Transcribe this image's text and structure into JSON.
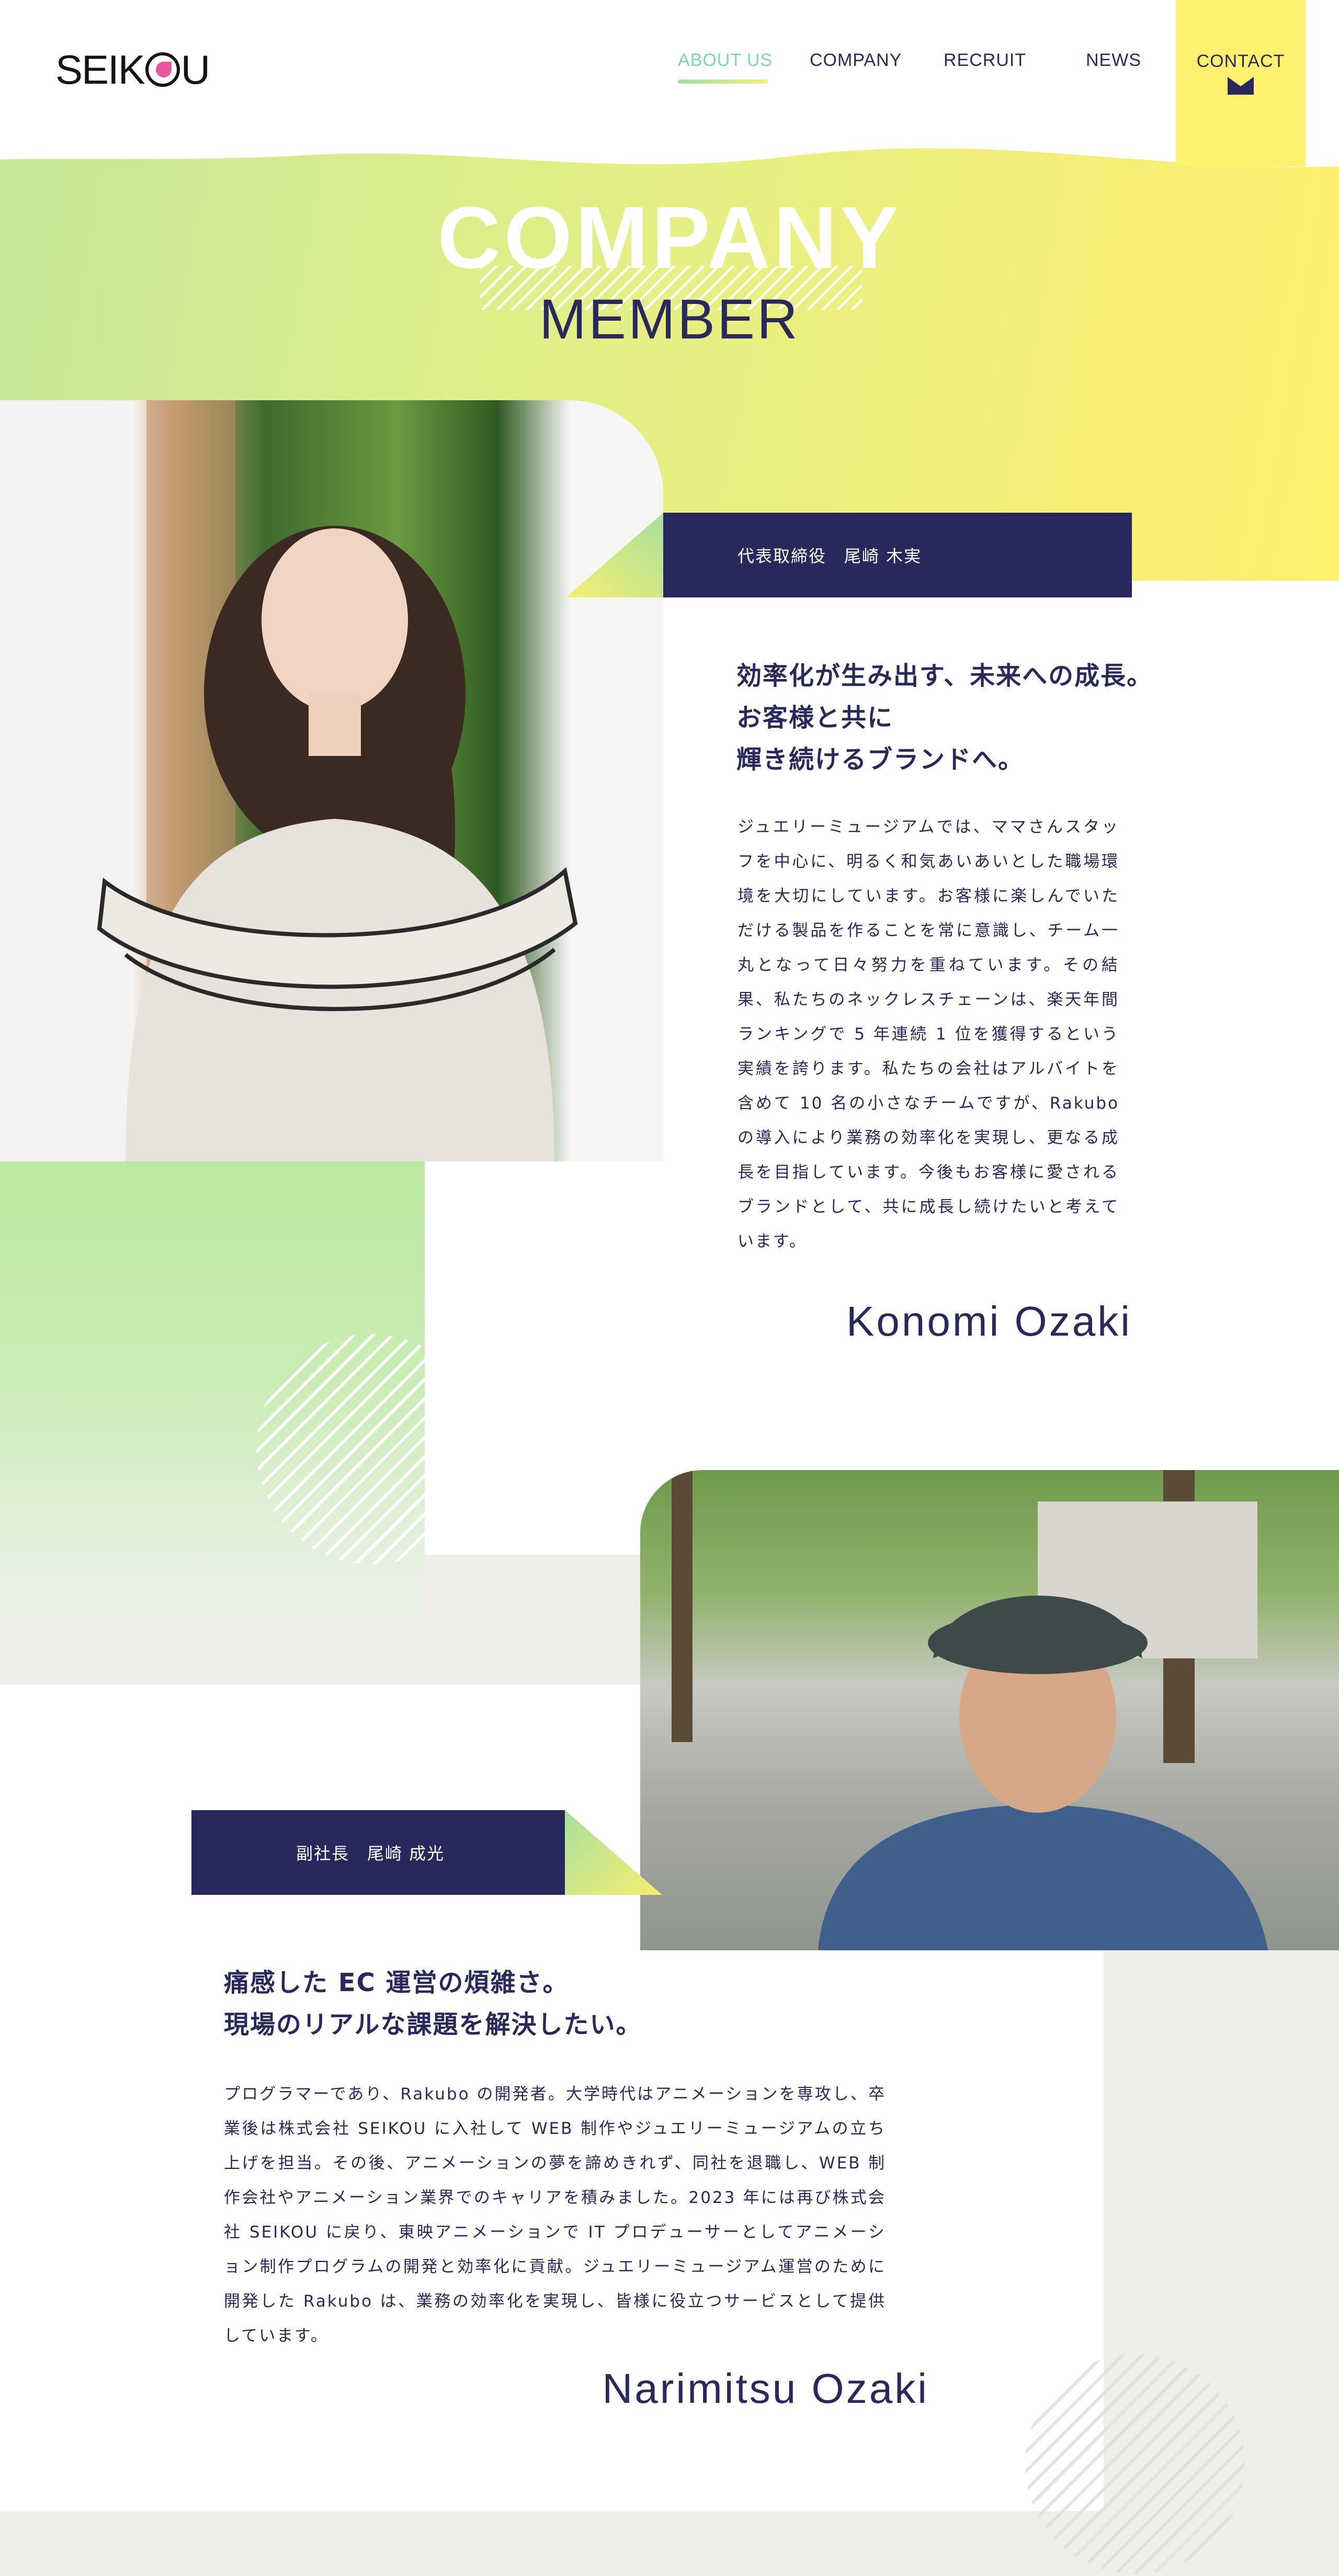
{
  "brand": {
    "logo_text_a": "SEIK",
    "logo_text_b": "U"
  },
  "nav": {
    "items": [
      {
        "label": "ABOUT US",
        "active": true
      },
      {
        "label": "COMPANY",
        "active": false
      },
      {
        "label": "RECRUIT",
        "active": false
      },
      {
        "label": "NEWS",
        "active": false
      }
    ],
    "contact_label": "CONTACT"
  },
  "hero": {
    "title": "COMPANY",
    "subtitle": "MEMBER"
  },
  "members": [
    {
      "role_name": "代表取締役　尾崎 木実",
      "lead": [
        "効率化が生み出す、未来への成長。",
        "お客様と共に",
        "輝き続けるブランドへ。"
      ],
      "body": "ジュエリーミュージアムでは、ママさんスタッフを中心に、明るく和気あいあいとした職場環境を大切にしています。お客様に楽しんでいただける製品を作ることを常に意識し、チーム一丸となって日々努力を重ねています。その結果、私たちのネックレスチェーンは、楽天年間ランキングで 5 年連続 1 位を獲得するという実績を誇ります。私たちの会社はアルバイトを含めて 10 名の小さなチームですが、Rakubo の導入により業務の効率化を実現し、更なる成長を目指しています。今後もお客様に愛されるブランドとして、共に成長し続けたいと考えています。",
      "signature": "Konomi Ozaki"
    },
    {
      "role_name": "副社長　尾崎 成光",
      "lead": [
        "痛感した EC 運営の煩雑さ。",
        "現場のリアルな課題を解決したい。"
      ],
      "body": "プログラマーであり、Rakubo の開発者。大学時代はアニメーションを専攻し、卒業後は株式会社 SEIKOU に入社して WEB 制作やジュエリーミュージアムの立ち上げを担当。その後、アニメーションの夢を諦めきれず、同社を退職し、WEB 制作会社やアニメーション業界でのキャリアを積みました。2023 年には再び株式会社 SEIKOU に戻り、東映アニメーションで IT プロデューサーとしてアニメーション制作プログラムの開発と効率化に貢献。ジュエリーミュージアム運営のために開発した Rakubo は、業務の効率化を実現し、皆様に役立つサービスとして提供しています。",
      "signature": "Narimitsu Ozaki"
    }
  ],
  "colors": {
    "navy": "#28285c",
    "accent_green": "#7fd6a6",
    "accent_yellow": "#fff06e",
    "logo_pink": "#e8569b"
  },
  "icons": {
    "contact": "mail-icon",
    "logo_mark": "flower-o-icon"
  }
}
